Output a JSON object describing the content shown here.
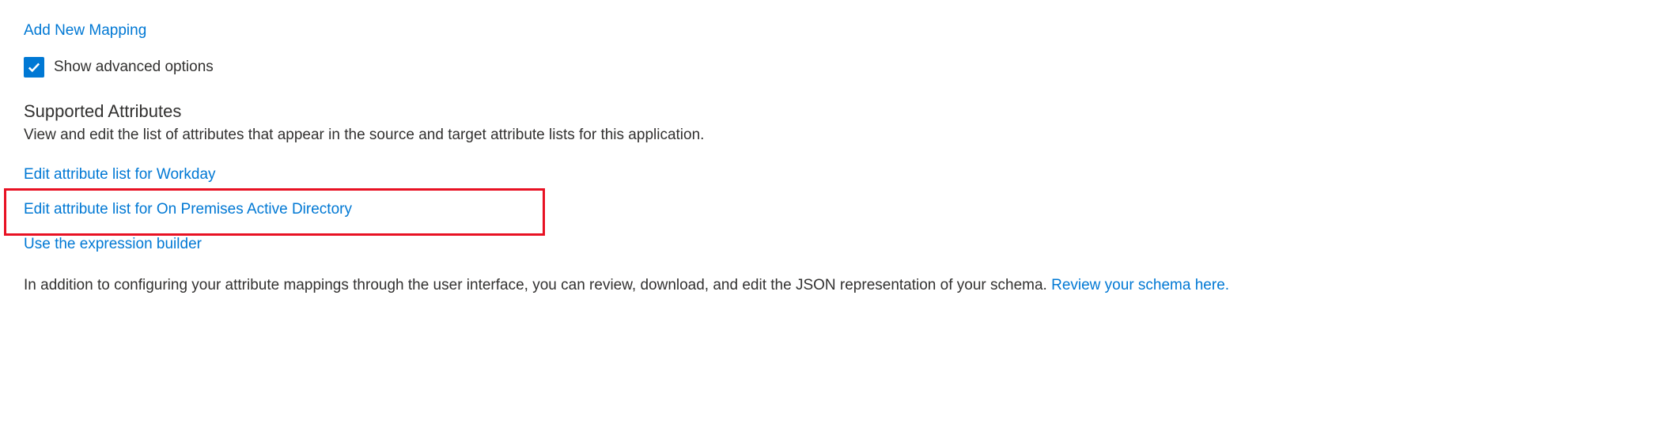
{
  "links": {
    "add_new_mapping": "Add New Mapping",
    "edit_workday": "Edit attribute list for Workday",
    "edit_onprem_ad": "Edit attribute list for On Premises Active Directory",
    "expression_builder": "Use the expression builder",
    "review_schema": "Review your schema here."
  },
  "checkbox": {
    "show_advanced_label": "Show advanced options",
    "checked": true
  },
  "section": {
    "title": "Supported Attributes",
    "description": "View and edit the list of attributes that appear in the source and target attribute lists for this application."
  },
  "paragraph": {
    "json_info": "In addition to configuring your attribute mappings through the user interface, you can review, download, and edit the JSON representation of your schema. "
  }
}
